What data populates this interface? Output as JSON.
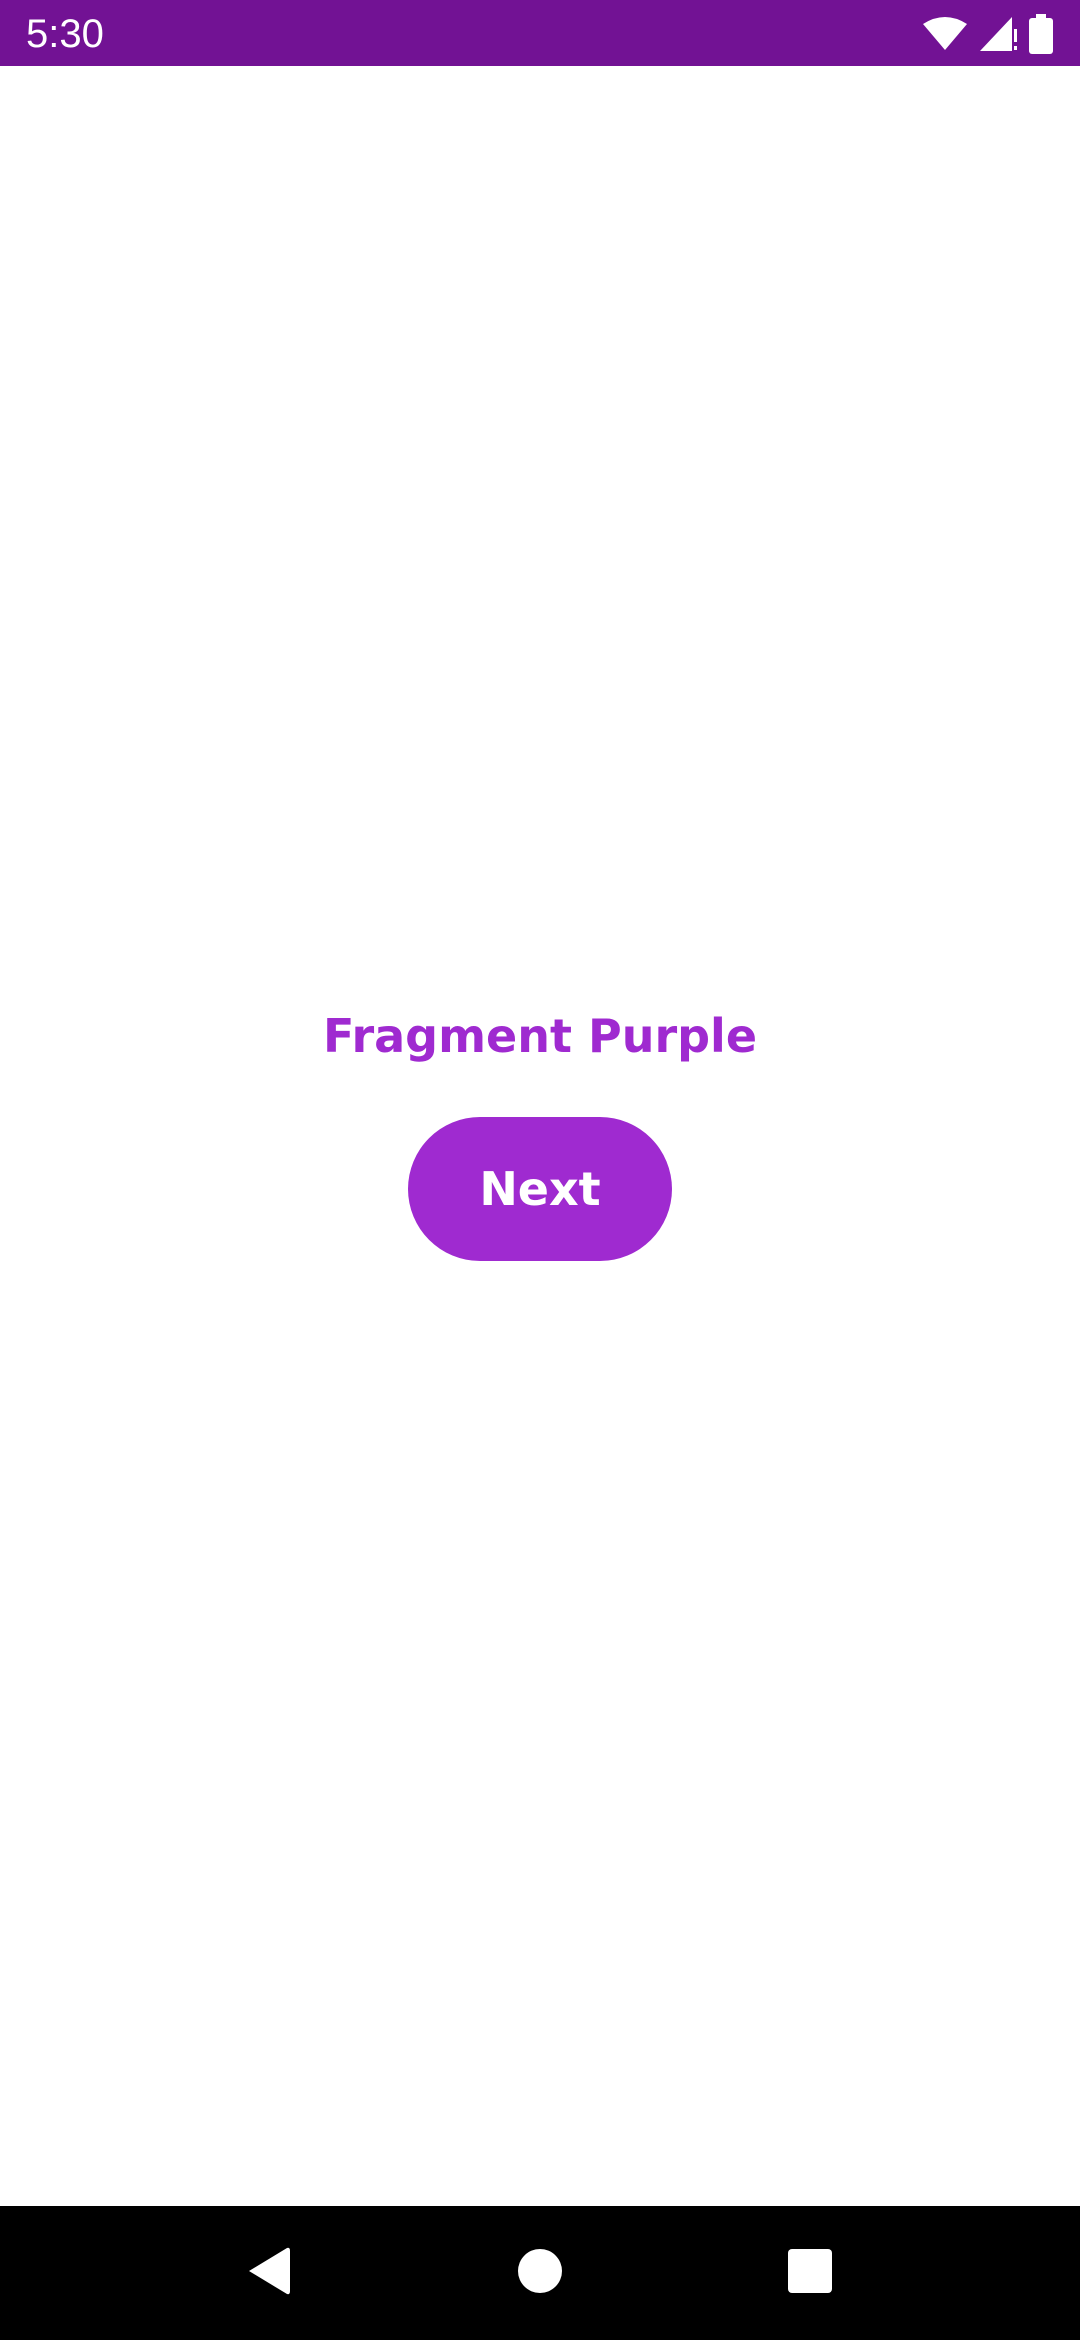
{
  "status_bar": {
    "time": "5:30",
    "icons": [
      "wifi-icon",
      "cell-signal-icon",
      "battery-icon"
    ],
    "color": "#721294"
  },
  "main": {
    "title": "Fragment Purple",
    "next_button_label": "Next",
    "accent_color": "#9f2ad0"
  },
  "nav_bar": {
    "buttons": [
      "back-icon",
      "home-icon",
      "recents-icon"
    ]
  }
}
